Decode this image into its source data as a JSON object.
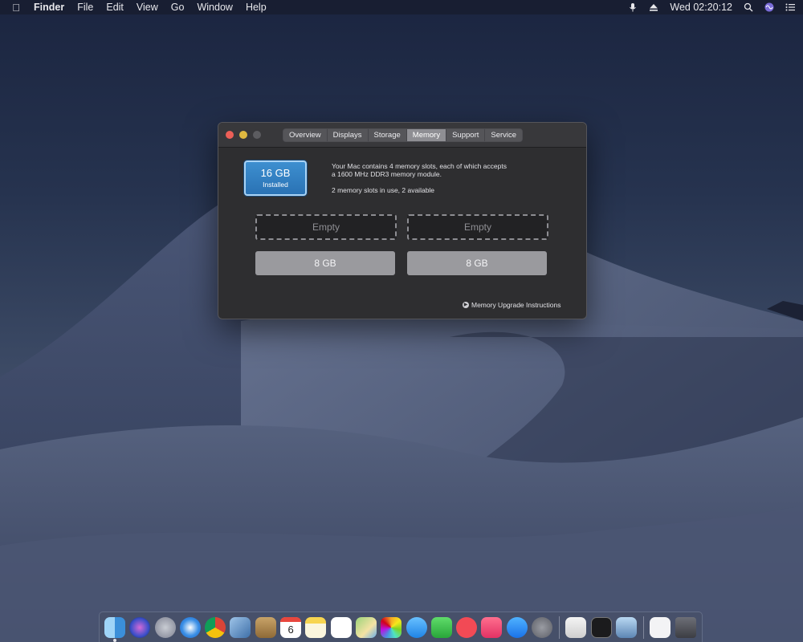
{
  "menubar": {
    "app_name": "Finder",
    "menus": [
      "File",
      "Edit",
      "View",
      "Go",
      "Window",
      "Help"
    ],
    "clock": "Wed 02:20:12"
  },
  "window": {
    "tabs": [
      {
        "label": "Overview",
        "active": false
      },
      {
        "label": "Displays",
        "active": false
      },
      {
        "label": "Storage",
        "active": false
      },
      {
        "label": "Memory",
        "active": true
      },
      {
        "label": "Support",
        "active": false
      },
      {
        "label": "Service",
        "active": false
      }
    ],
    "installed": {
      "size": "16 GB",
      "label": "Installed"
    },
    "description": {
      "line1": "Your Mac contains 4 memory slots, each of which accepts",
      "line2": "a 1600 MHz DDR3 memory module.",
      "usage": "2 memory slots in use, 2 available"
    },
    "slots": [
      {
        "label": "Empty",
        "state": "empty"
      },
      {
        "label": "Empty",
        "state": "empty"
      },
      {
        "label": "8 GB",
        "state": "filled"
      },
      {
        "label": "8 GB",
        "state": "filled"
      }
    ],
    "upgrade_link": "Memory Upgrade Instructions"
  },
  "dock": {
    "calendar_day": "6",
    "apps": [
      "finder-icon",
      "siri-icon",
      "launchpad-icon",
      "safari-icon",
      "chrome-icon",
      "preview-icon",
      "contacts-icon",
      "calendar-icon",
      "notes-icon",
      "reminders-icon",
      "maps-icon",
      "photos-icon",
      "messages-icon",
      "facetime-icon",
      "news-icon",
      "music-icon",
      "app-store-icon",
      "system-preferences-icon",
      "textedit-icon",
      "terminal-icon",
      "image-capture-icon",
      "document-icon",
      "trash-icon"
    ]
  },
  "colors": {
    "accent": "#2a72b4",
    "window_bg": "#2e2e30",
    "close": "#ec5f57",
    "minimize": "#e0b940"
  }
}
